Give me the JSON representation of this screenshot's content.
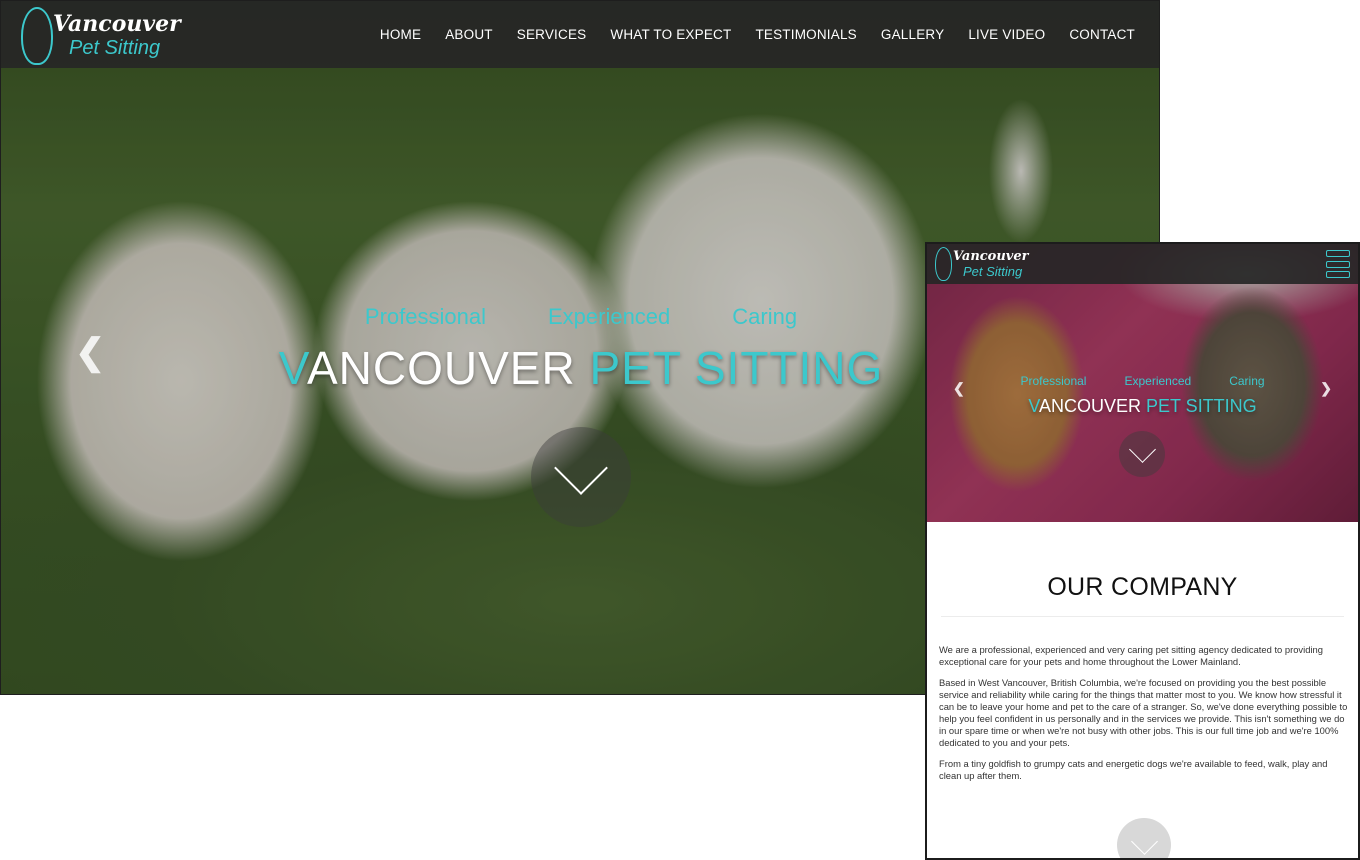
{
  "brand": {
    "line1": "Vancouver",
    "line2": "Pet Sitting"
  },
  "nav": {
    "items": [
      {
        "label": "HOME"
      },
      {
        "label": "ABOUT"
      },
      {
        "label": "SERVICES"
      },
      {
        "label": "WHAT TO EXPECT"
      },
      {
        "label": "TESTIMONIALS"
      },
      {
        "label": "GALLERY"
      },
      {
        "label": "LIVE VIDEO"
      },
      {
        "label": "CONTACT"
      }
    ]
  },
  "hero": {
    "taglines": [
      "Professional",
      "Experienced",
      "Caring"
    ],
    "title_first": "V",
    "title_rest": "ANCOUVER ",
    "title_accent": "PET SITTING",
    "prev_icon": "chevron-left-icon",
    "next_icon": "chevron-right-icon",
    "scroll_icon": "chevron-down-icon"
  },
  "mobile": {
    "menu_icon": "hamburger-menu-icon",
    "section_title": "OUR COMPANY",
    "paragraphs": [
      "We are a professional, experienced and very caring pet sitting agency dedicated to providing exceptional care for your pets and home throughout the Lower Mainland.",
      "Based in West Vancouver, British Columbia, we're focused on providing you the best possible service and reliability while caring for the things that matter most to you. We know how stressful it can be to leave your home and pet to the care of a stranger. So, we've done everything possible to help you feel confident in us personally and in the services we provide. This isn't something we do in our spare time or when we're not busy with other jobs. This is our full time job and we're 100% dedicated to you and your pets.",
      "From a tiny goldfish to grumpy cats and energetic dogs we're available to feed, walk, play and clean up after them."
    ]
  },
  "colors": {
    "accent": "#3cc8cc",
    "nav_bg": "#262626",
    "text_white": "#ffffff"
  }
}
